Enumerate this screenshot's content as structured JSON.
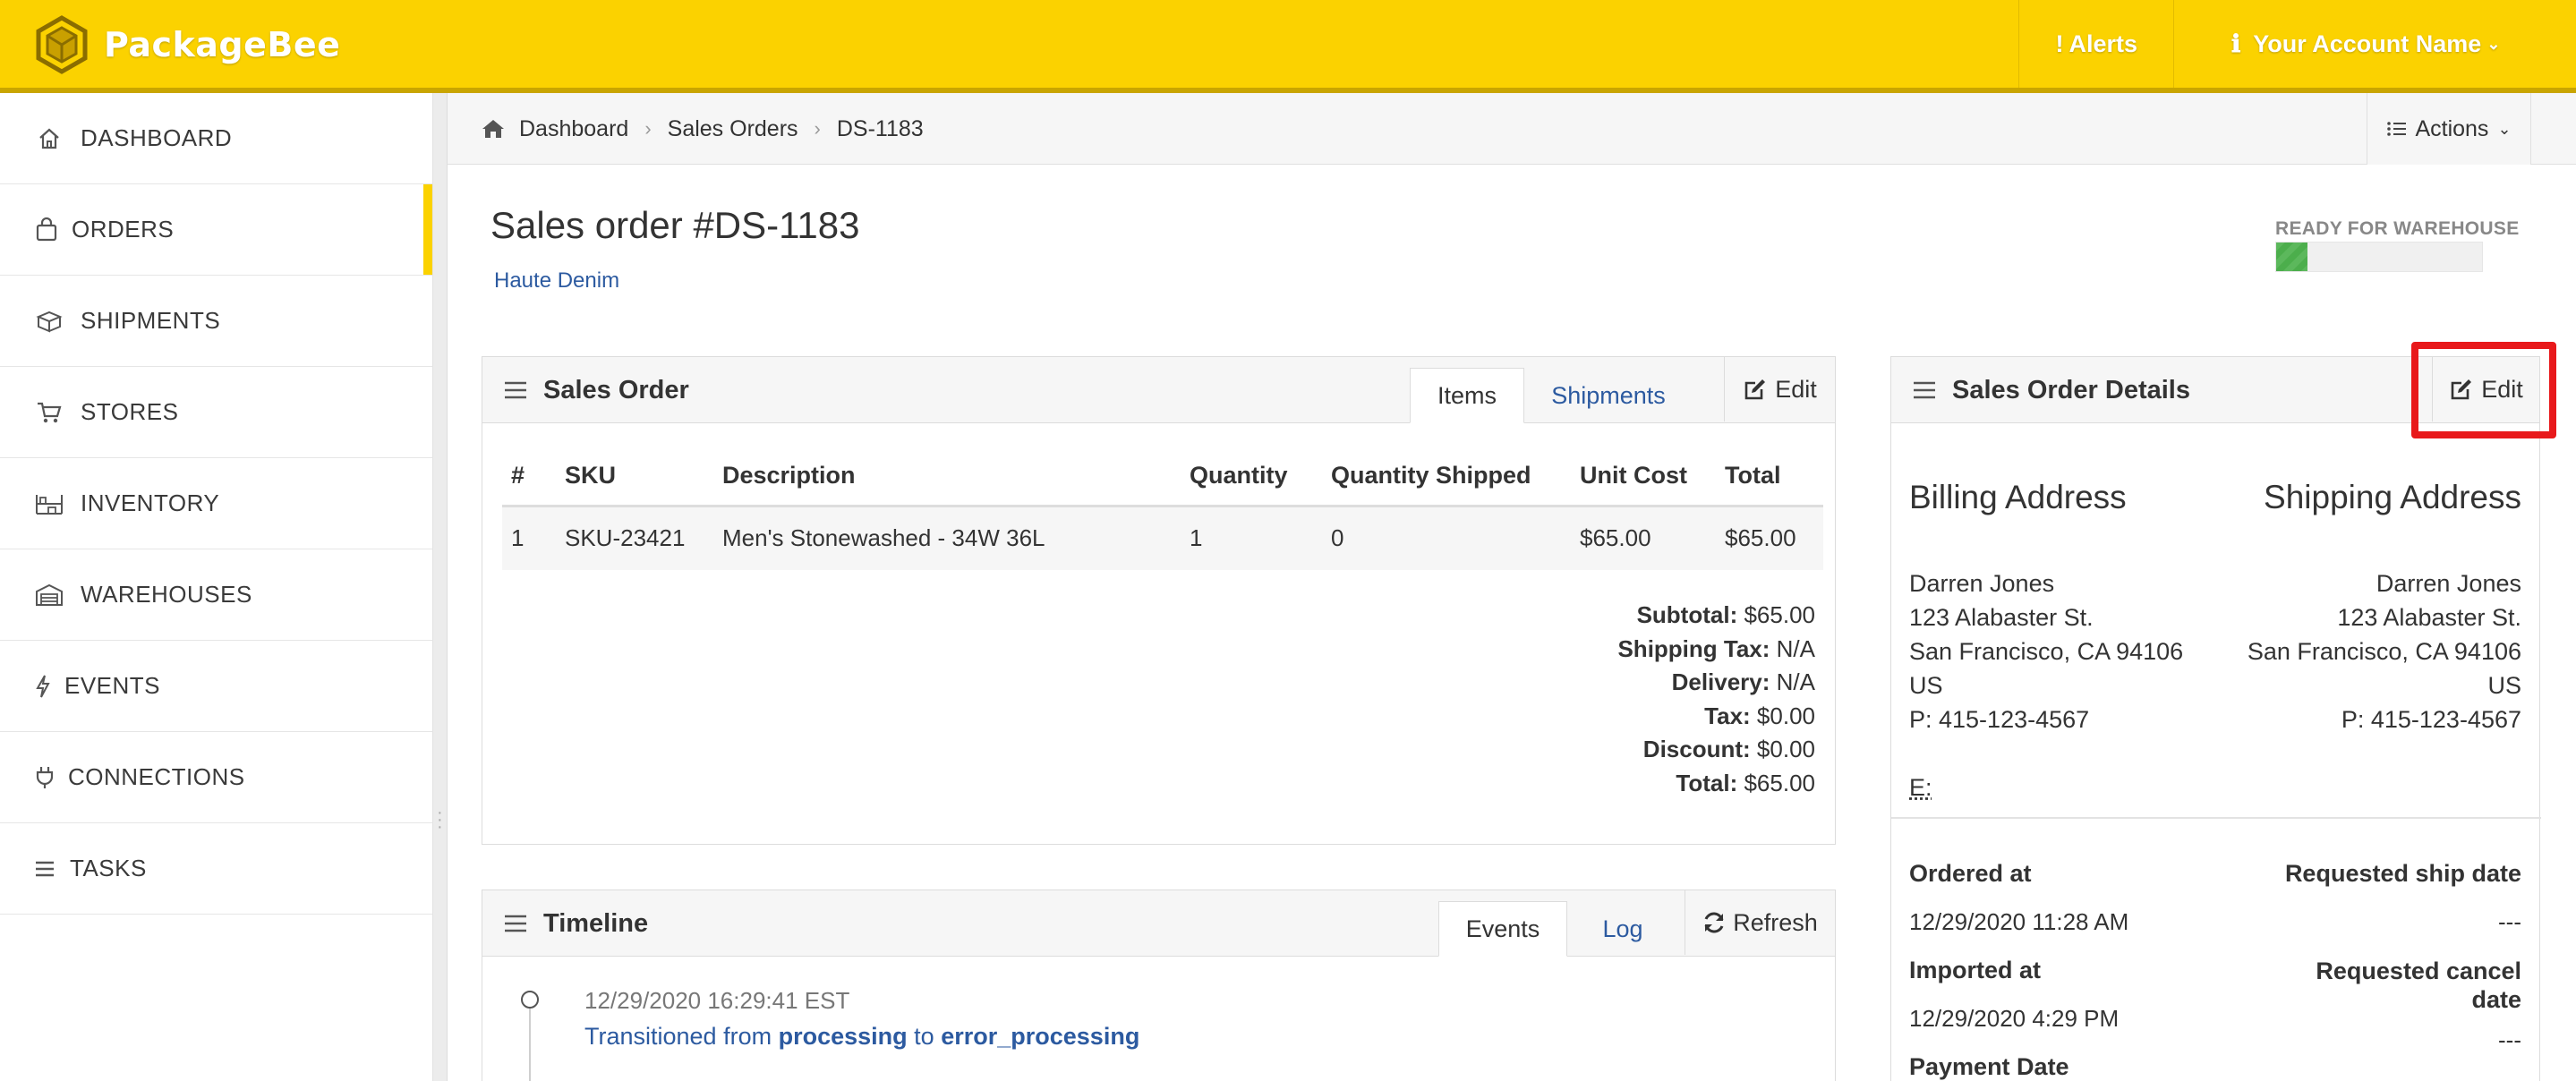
{
  "app": {
    "name": "PackageBee"
  },
  "topbar": {
    "alerts_label": "Alerts",
    "account_label": "Your Account Name"
  },
  "sidebar": {
    "items": [
      {
        "label": "DASHBOARD",
        "icon": "home-icon"
      },
      {
        "label": "ORDERS",
        "icon": "bag-icon",
        "active": true
      },
      {
        "label": "SHIPMENTS",
        "icon": "box-icon"
      },
      {
        "label": "STORES",
        "icon": "cart-icon"
      },
      {
        "label": "INVENTORY",
        "icon": "shelves-icon"
      },
      {
        "label": "WAREHOUSES",
        "icon": "warehouse-icon"
      },
      {
        "label": "EVENTS",
        "icon": "bolt-icon"
      },
      {
        "label": "CONNECTIONS",
        "icon": "plug-icon"
      },
      {
        "label": "TASKS",
        "icon": "list-icon"
      }
    ]
  },
  "breadcrumb": {
    "items": [
      "Dashboard",
      "Sales Orders",
      "DS-1183"
    ]
  },
  "actions_label": "Actions",
  "page": {
    "title": "Sales order #DS-1183",
    "store": "Haute Denim"
  },
  "status": {
    "label": "READY FOR WAREHOUSE",
    "progress": 0.15,
    "color": "#5cb85c"
  },
  "sales_order_panel": {
    "title": "Sales Order",
    "tabs": [
      "Items",
      "Shipments"
    ],
    "active_tab": "Items",
    "edit_label": "Edit",
    "columns": [
      "#",
      "SKU",
      "Description",
      "Quantity",
      "Quantity Shipped",
      "Unit Cost",
      "Total"
    ],
    "rows": [
      [
        "1",
        "SKU-23421",
        "Men's Stonewashed - 34W 36L",
        "1",
        "0",
        "$65.00",
        "$65.00"
      ]
    ],
    "totals": [
      {
        "label": "Subtotal:",
        "value": "$65.00"
      },
      {
        "label": "Shipping Tax:",
        "value": "N/A"
      },
      {
        "label": "Delivery:",
        "value": "N/A"
      },
      {
        "label": "Tax:",
        "value": "$0.00"
      },
      {
        "label": "Discount:",
        "value": "$0.00"
      },
      {
        "label": "Total:",
        "value": "$65.00"
      }
    ]
  },
  "details_panel": {
    "title": "Sales Order Details",
    "edit_label": "Edit",
    "billing": {
      "heading": "Billing Address",
      "name": "Darren Jones",
      "street": "123 Alabaster St.",
      "city": "San Francisco, CA 94106",
      "country": "US",
      "phone": "P: 415-123-4567",
      "email": "E:"
    },
    "shipping": {
      "heading": "Shipping Address",
      "name": "Darren Jones",
      "street": "123 Alabaster St.",
      "city": "San Francisco, CA 94106",
      "country": "US",
      "phone": "P: 415-123-4567"
    },
    "ordered_at_label": "Ordered at",
    "ordered_at": "12/29/2020 11:28 AM",
    "requested_ship_label": "Requested ship date",
    "requested_ship": "---",
    "imported_at_label": "Imported at",
    "imported_at": "12/29/2020 4:29 PM",
    "requested_cancel_label_1": "Requested cancel",
    "requested_cancel_label_2": "date",
    "requested_cancel": "---",
    "payment_date_label": "Payment Date"
  },
  "timeline_panel": {
    "title": "Timeline",
    "tabs": [
      "Events",
      "Log"
    ],
    "active_tab": "Events",
    "refresh_label": "Refresh",
    "events": [
      {
        "time": "12/29/2020 16:29:41 EST",
        "prefix": "Transitioned from",
        "from": "processing",
        "mid": "to",
        "to": "error_processing"
      }
    ]
  },
  "colors": {
    "brand": "#fbd200",
    "link": "#2c5aa0",
    "highlight": "#e8191b"
  }
}
